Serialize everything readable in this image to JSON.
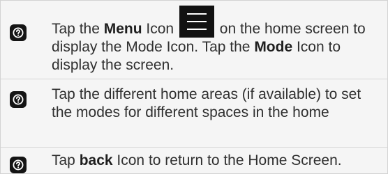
{
  "steps": [
    {
      "icon": "question-mark-icon",
      "seg1": "Tap the ",
      "bold1": "Menu",
      "seg2": " Icon ",
      "inline_icon": "hamburger-menu-icon",
      "seg3": " on the home screen to display the Mode Icon. Tap the ",
      "bold2": "Mode",
      "seg4": " Icon to display the screen."
    },
    {
      "icon": "question-mark-icon",
      "text": "Tap the different home areas (if available) to set the modes for different spaces in the home"
    },
    {
      "icon": "question-mark-icon",
      "seg1": "Tap ",
      "bold1": "back",
      "seg2": " Icon to return to the Home Screen."
    }
  ],
  "colors": {
    "icon_background": "#141414",
    "icon_glyph": "#ffffff",
    "text": "#2f2f2f",
    "background": "#f5f5f5",
    "divider": "#d6d6d6"
  }
}
